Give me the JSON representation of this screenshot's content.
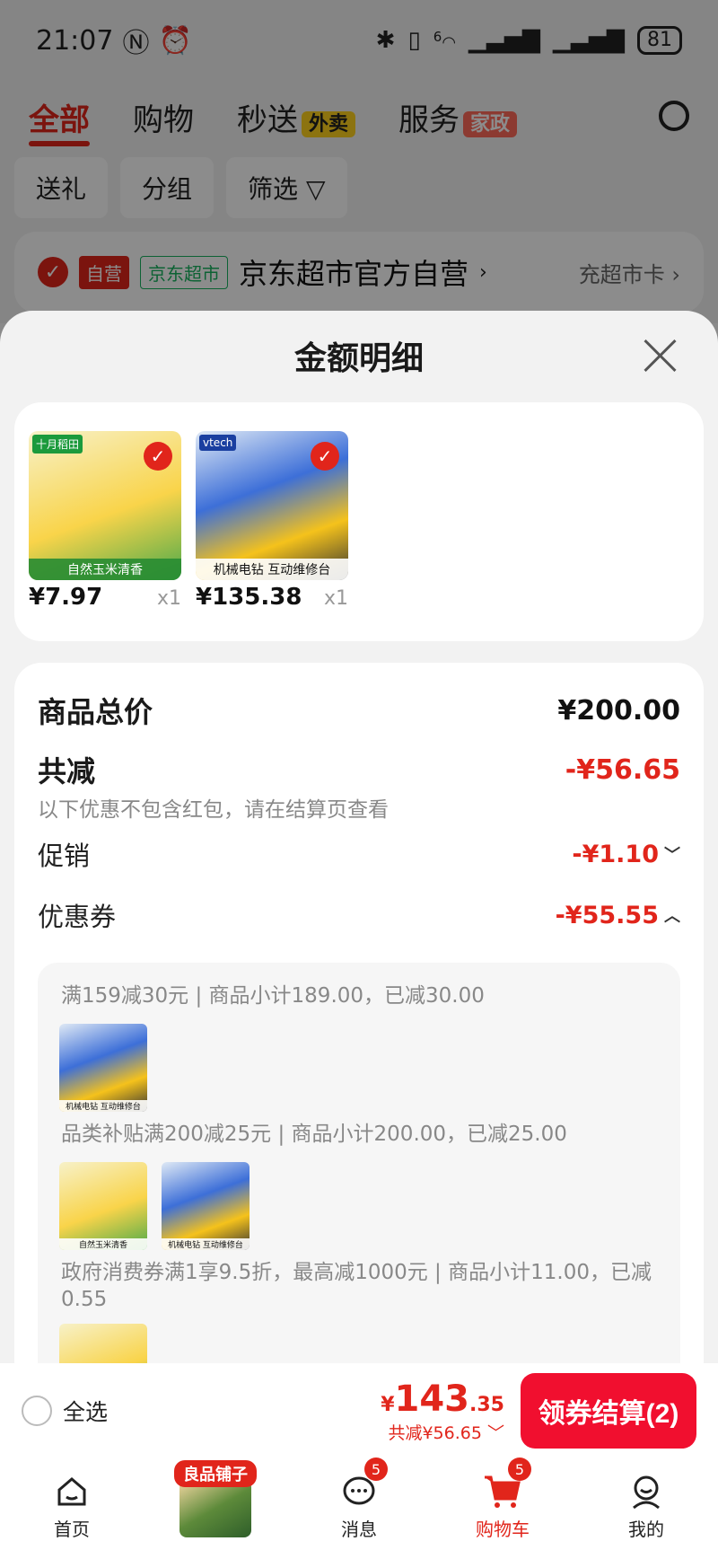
{
  "status_bar": {
    "time": "21:07",
    "battery": "81",
    "signal": "6"
  },
  "top_tabs": {
    "items": [
      {
        "label": "全部"
      },
      {
        "label": "购物"
      },
      {
        "label": "秒送",
        "badge": "外卖"
      },
      {
        "label": "服务",
        "badge": "家政"
      }
    ]
  },
  "filter_chips": [
    "送礼",
    "分组",
    "筛选"
  ],
  "store": {
    "tag_self": "自营",
    "tag_market": "京东超市",
    "name": "京东超市官方自营",
    "right_link": "充超市卡"
  },
  "sheet": {
    "title": "金额明细",
    "products": [
      {
        "price": "¥7.97",
        "qty": "x1",
        "brand": "十月稻田",
        "caption": "自然玉米清香"
      },
      {
        "price": "¥135.38",
        "qty": "x1",
        "brand": "vtech",
        "caption": "机械电钻 互动维修台"
      }
    ],
    "summary": {
      "total_label": "商品总价",
      "total_value": "¥200.00",
      "reduce_label": "共减",
      "reduce_value": "-¥56.65",
      "note": "以下优惠不包含红包，请在结算页查看",
      "promo_label": "促销",
      "promo_value": "-¥1.10",
      "coupon_label": "优惠券",
      "coupon_value": "-¥55.55"
    },
    "coupons": [
      {
        "text": "满159减30元 | 商品小计189.00，已减30.00"
      },
      {
        "text": "品类补贴满200减25元 | 商品小计200.00，已减25.00"
      },
      {
        "text": "政府消费券满1享9.5折，最高减1000元 | 商品小计11.00，已减0.55"
      }
    ]
  },
  "checkout": {
    "select_all": "全选",
    "price_yen": "¥",
    "price_int": "143",
    "price_dec": ".35",
    "saved": "共减¥56.65",
    "button": "领券结算(2)"
  },
  "bottom_nav": {
    "items": [
      {
        "label": "首页"
      },
      {
        "label": "",
        "promo": "良品铺子"
      },
      {
        "label": "消息",
        "badge": "5"
      },
      {
        "label": "购物车",
        "badge": "5"
      },
      {
        "label": "我的"
      }
    ]
  },
  "colors": {
    "accent": "#e1251b",
    "button": "#f10f2f"
  }
}
